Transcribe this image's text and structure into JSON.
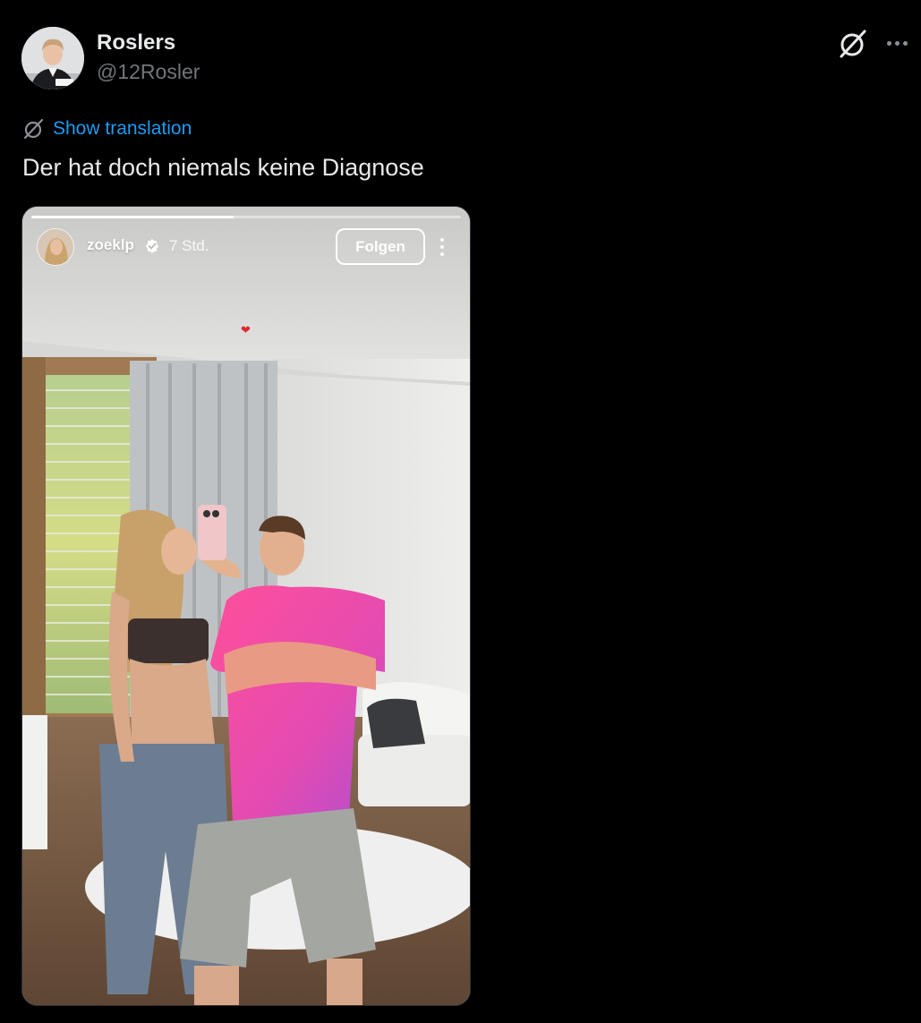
{
  "tweet": {
    "author_name": "Roslers",
    "author_handle": "@12Rosler",
    "show_translation_label": "Show translation",
    "text": "Der hat doch niemals keine Diagnose"
  },
  "icons": {
    "grok": "grok-icon",
    "more": "more-options-icon",
    "translate": "translate-icon",
    "verified": "verified-badge-icon",
    "heart": "heart-icon"
  },
  "story": {
    "username": "zoeklp",
    "time": "7 Std.",
    "follow_label": "Folgen",
    "progress": 0.47
  },
  "colors": {
    "background": "#000000",
    "text_primary": "#e7e9ea",
    "text_secondary": "#71767b",
    "link": "#1d9bf0"
  }
}
